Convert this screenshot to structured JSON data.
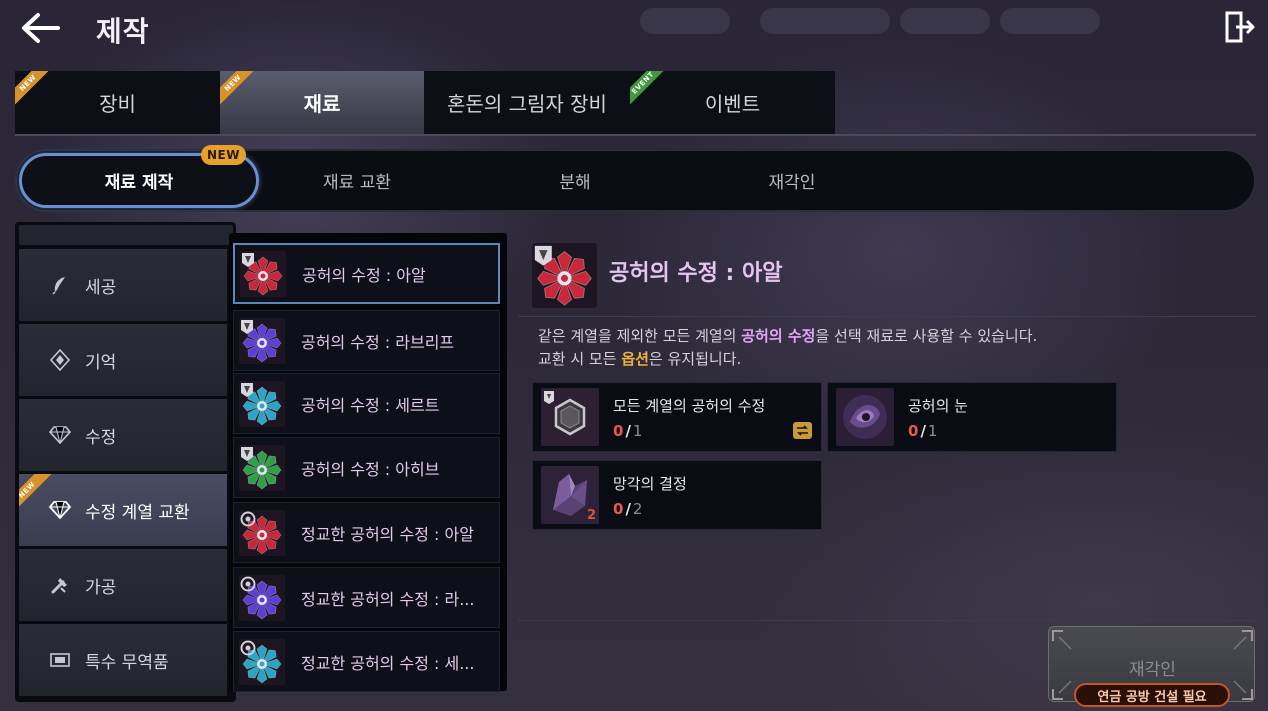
{
  "header": {
    "title": "제작"
  },
  "main_tabs": [
    {
      "label": "장비",
      "badge": "NEW"
    },
    {
      "label": "재료",
      "badge": "NEW",
      "active": true
    },
    {
      "label": "혼돈의 그림자 장비",
      "badge": ""
    },
    {
      "label": "이벤트",
      "badge": "EVENT"
    }
  ],
  "sub_tabs": [
    {
      "label": "재료 제작",
      "active": true,
      "badge": "NEW"
    },
    {
      "label": "재료 교환"
    },
    {
      "label": "분해"
    },
    {
      "label": "재각인"
    }
  ],
  "categories": [
    {
      "label": "세공",
      "icon": "feather-icon"
    },
    {
      "label": "기억",
      "icon": "diamond-frame-icon"
    },
    {
      "label": "수정",
      "icon": "gem-icon"
    },
    {
      "label": "수정 계열 교환",
      "icon": "gem-icon",
      "badge": "NEW",
      "active": true
    },
    {
      "label": "가공",
      "icon": "tools-icon"
    },
    {
      "label": "특수 무역품",
      "icon": "ticket-icon"
    }
  ],
  "recipes": [
    {
      "label": "공허의 수정 : 아알",
      "color": "#c8283a",
      "selected": true
    },
    {
      "label": "공허의 수정 : 라브리프",
      "color": "#5b3fd6"
    },
    {
      "label": "공허의 수정 : 세르트",
      "color": "#2aa6c4"
    },
    {
      "label": "공허의 수정 : 아히브",
      "color": "#2fa04a"
    },
    {
      "label": "정교한 공허의 수정 : 아알",
      "color": "#c8283a"
    },
    {
      "label": "정교한 공허의 수정 : 라...",
      "color": "#5b3fd6"
    },
    {
      "label": "정교한 공허의 수정 : 세...",
      "color": "#2aa6c4"
    }
  ],
  "detail": {
    "title": "공허의 수정 : 아알",
    "desc1_pre": "같은 계열을 제외한 모든 계열의 ",
    "desc1_hl": "공허의 수정",
    "desc1_post": "을 선택 재료로 사용할 수 있습니다.",
    "desc2_pre": "교환 시 모든 ",
    "desc2_hl": "옵션",
    "desc2_post": "은 유지됩니다."
  },
  "materials": [
    {
      "name": "모든 계열의 공허의 수정",
      "have": "0",
      "need": "1",
      "icon": "hexagon-icon"
    },
    {
      "name": "공허의 눈",
      "have": "0",
      "need": "1",
      "icon": "void-eye-icon"
    },
    {
      "name": "망각의 결정",
      "have": "0",
      "need": "2",
      "qty": "2",
      "icon": "crystal-icon"
    }
  ],
  "action": {
    "label": "재각인",
    "requirement": "연금 공방 건설 필요"
  },
  "colors": {
    "accent_blue": "#6a8fcf",
    "new_badge": "#e6a12c",
    "title_purple": "#e6c4f2",
    "warn_red": "#e65a4a"
  }
}
